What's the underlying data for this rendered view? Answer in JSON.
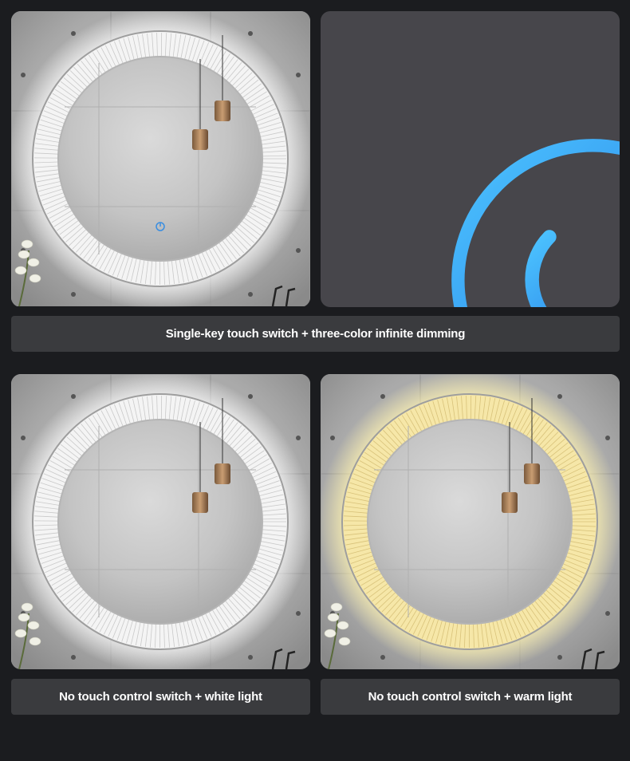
{
  "captions": {
    "top": "Single-key touch switch + three-color infinite dimming",
    "bottom_left": "No touch control switch + white light",
    "bottom_right": "No touch control switch + warm light"
  },
  "panels": [
    {
      "id": "mirror-touch",
      "light": "white",
      "has_touch_icon": true
    },
    {
      "id": "power-closeup",
      "icon": "power-icon"
    },
    {
      "id": "mirror-white",
      "light": "white",
      "has_touch_icon": false
    },
    {
      "id": "mirror-warm",
      "light": "warm",
      "has_touch_icon": false
    }
  ],
  "colors": {
    "background": "#1b1c1f",
    "caption_bg": "#3a3b3e",
    "caption_text": "#ffffff",
    "closeup_bg": "#47464b",
    "power_icon": "#2f9cf0",
    "white_light": "#ffffff",
    "warm_light": "#f3e3a2"
  }
}
